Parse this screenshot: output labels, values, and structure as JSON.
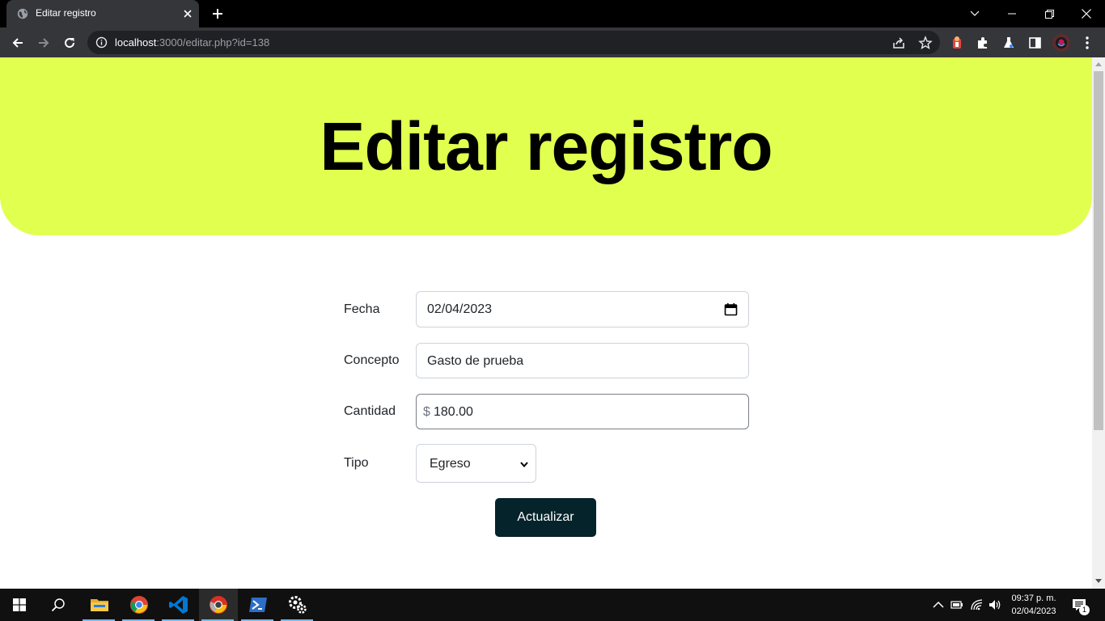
{
  "browser": {
    "tab_title": "Editar registro",
    "url_host": "localhost",
    "url_path": ":3000/editar.php?id=138"
  },
  "page": {
    "heading": "Editar registro",
    "form": {
      "fecha_label": "Fecha",
      "fecha_value": "02/04/2023",
      "concepto_label": "Concepto",
      "concepto_value": "Gasto de prueba",
      "cantidad_label": "Cantidad",
      "cantidad_prefix": "$",
      "cantidad_value": "180.00",
      "tipo_label": "Tipo",
      "tipo_value": "Egreso",
      "submit_label": "Actualizar"
    }
  },
  "taskbar": {
    "time": "09:37 p. m.",
    "date": "02/04/2023",
    "notification_count": "1"
  },
  "colors": {
    "hero_bg": "#e1ff4f",
    "button_bg": "#05232a",
    "browser_chrome": "#35363a"
  },
  "icons": [
    "globe-icon",
    "close-icon",
    "plus-icon",
    "chevron-down-icon",
    "minimize-icon",
    "restore-icon",
    "back-arrow-icon",
    "forward-arrow-icon",
    "reload-icon",
    "info-icon",
    "share-icon",
    "star-icon",
    "extension-icon",
    "puzzle-icon",
    "labs-icon",
    "side-panel-icon",
    "profile-avatar-icon",
    "menu-dots-icon",
    "calendar-icon",
    "windows-start-icon",
    "search-icon",
    "file-explorer-icon",
    "chrome-icon",
    "vscode-icon",
    "chrome-dev-icon",
    "powershell-icon",
    "settings-gear-icon",
    "wifi-icon",
    "volume-icon",
    "battery-icon",
    "notifications-icon"
  ]
}
